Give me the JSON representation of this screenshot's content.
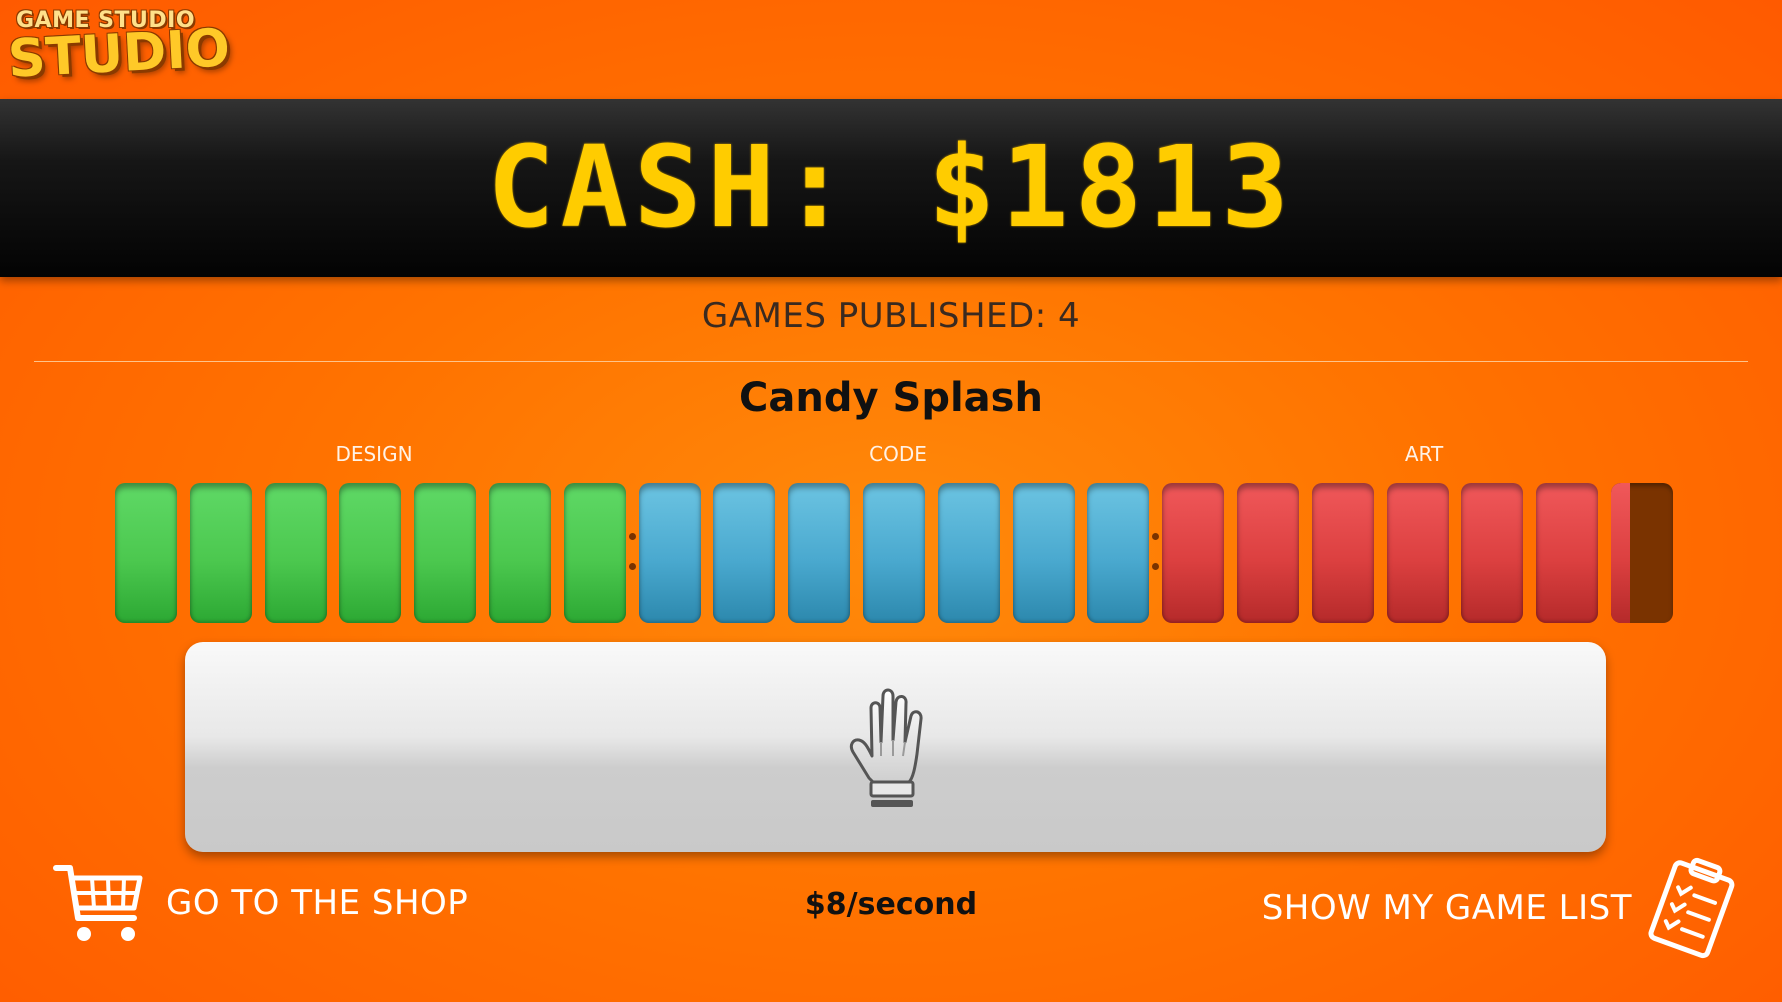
{
  "logo": {
    "small_text": "GAME STUDIO",
    "large_text": "STUDIO"
  },
  "cash": {
    "text": "CASH: $1813"
  },
  "games_published": {
    "text": "GAMES PUBLISHED: 4"
  },
  "current_game": {
    "name": "Candy Splash"
  },
  "progress": {
    "sections": [
      {
        "label": "DESIGN",
        "color": "#4cc84f",
        "segments_total": 7,
        "segments_complete": 7
      },
      {
        "label": "CODE",
        "color": "#4aa9cf",
        "segments_total": 7,
        "segments_complete": 7
      },
      {
        "label": "ART",
        "color": "#dc4040",
        "segments_total": 7,
        "segments_complete": 6.3
      }
    ],
    "incomplete_color": "#7a3300"
  },
  "work_button": {
    "icon": "hand-icon"
  },
  "footer": {
    "shop_label": "GO TO THE SHOP",
    "shop_icon": "shopping-cart-icon",
    "rate_text": "$8/second",
    "list_label": "SHOW MY GAME LIST",
    "list_icon": "clipboard-checklist-icon"
  },
  "colors": {
    "background": "#ff7300",
    "cash_text": "#ffcc00",
    "banner": "#0a0a0a"
  }
}
